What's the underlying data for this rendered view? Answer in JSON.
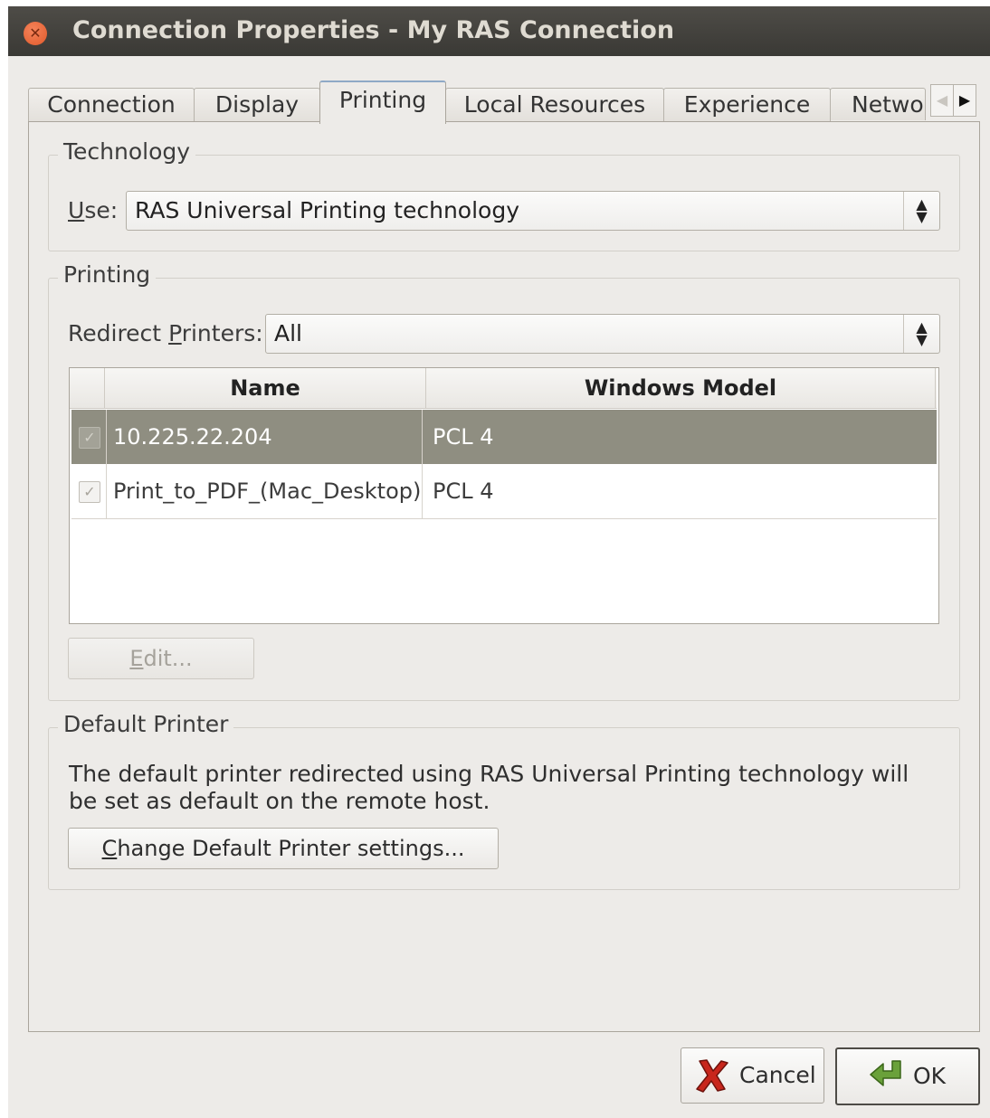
{
  "window": {
    "title": "Connection Properties - My RAS Connection"
  },
  "tabs": [
    {
      "label": "Connection"
    },
    {
      "label": "Display"
    },
    {
      "label": "Printing"
    },
    {
      "label": "Local Resources"
    },
    {
      "label": "Experience"
    },
    {
      "label": "Netwo"
    }
  ],
  "technology": {
    "group_title": "Technology",
    "use_label": "Use:",
    "use_value": "RAS Universal Printing technology"
  },
  "printing": {
    "group_title": "Printing",
    "redirect_label": "Redirect Printers:",
    "redirect_value": "All",
    "columns": {
      "name": "Name",
      "model": "Windows Model"
    },
    "rows": [
      {
        "name": "10.225.22.204",
        "model": "PCL 4",
        "checked": true,
        "selected": true
      },
      {
        "name": "Print_to_PDF_(Mac_Desktop)",
        "model": "PCL 4",
        "checked": true,
        "selected": false
      }
    ],
    "edit_label": "Edit..."
  },
  "default_printer": {
    "group_title": "Default Printer",
    "description": "The default printer redirected using RAS Universal Printing technology will be set as default on the remote host.",
    "change_label": "Change Default Printer settings..."
  },
  "buttons": {
    "cancel": "Cancel",
    "ok": "OK"
  },
  "icons": {
    "close": "close-icon",
    "check": "checkmark-icon",
    "cancel": "red-x-icon",
    "ok": "green-arrow-icon",
    "tab_left": "arrow-left-icon",
    "tab_right": "arrow-right-icon",
    "combo": "up-down-arrows-icon"
  },
  "colors": {
    "titlebar": "#3f3e3a",
    "selected_row": "#8f8e81",
    "close_button": "#e96a3c"
  }
}
